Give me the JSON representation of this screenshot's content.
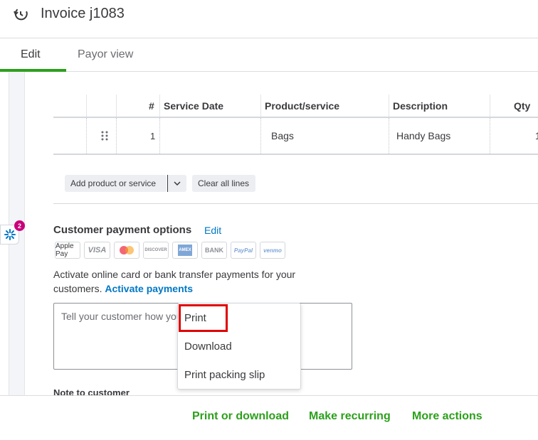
{
  "header": {
    "title": "Invoice j1083",
    "icon": "history-icon"
  },
  "tabs": [
    {
      "label": "Edit"
    },
    {
      "label": "Payor view"
    }
  ],
  "table": {
    "columns": [
      "#",
      "Service Date",
      "Product/service",
      "Description",
      "Qty"
    ],
    "rows": [
      {
        "num": "1",
        "service_date": "",
        "product": "Bags",
        "description": "Handy Bags",
        "qty": "1"
      }
    ]
  },
  "line_actions": {
    "add_label": "Add product or service",
    "clear_label": "Clear all lines"
  },
  "assistant": {
    "badge": "2"
  },
  "payment_options": {
    "title": "Customer payment options",
    "edit_label": "Edit",
    "methods": [
      "Apple Pay",
      "VISA",
      "Mastercard",
      "DISCOVER",
      "AMEX",
      "BANK",
      "PayPal",
      "venmo"
    ],
    "activate_text": "Activate online card or bank transfer payments for your customers.",
    "activate_link": "Activate payments"
  },
  "message": {
    "placeholder": "Tell your customer how you"
  },
  "note_label": "Note to customer",
  "dropdown": {
    "items": [
      "Print",
      "Download",
      "Print packing slip"
    ]
  },
  "footer": {
    "print_download": "Print or download",
    "make_recurring": "Make recurring",
    "more_actions": "More actions"
  },
  "colors": {
    "accent": "#2ca01c",
    "link": "#0077c5",
    "highlight": "#e00000"
  }
}
